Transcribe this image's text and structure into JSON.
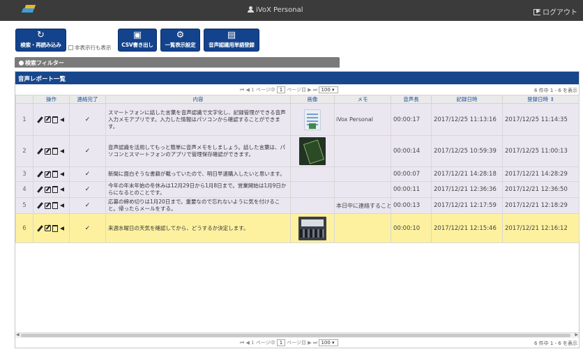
{
  "header": {
    "logo_text": "iVoX Personal",
    "title": "iVoX Personal",
    "logout_label": "ログアウト"
  },
  "toolbar": {
    "search_label": "検索・再読み込み",
    "show_hidden_label": "非表示行も表示",
    "csv_label": "CSV書き出し",
    "list_settings_label": "一覧表示設定",
    "word_register_label": "音声認識用単語登録"
  },
  "filter": {
    "label": "検索フィルター"
  },
  "panel": {
    "title": "音声レポート一覧"
  },
  "pager_top": {
    "prefix": "1 ページ中",
    "current_page": "1",
    "suffix": "ページ目",
    "page_size": "100 ▾",
    "count_text": "6 件中 1 - 6 を表示"
  },
  "pager_bottom": {
    "prefix": "1 ページ中",
    "current_page": "1",
    "suffix": "ページ目",
    "page_size": "100 ▾",
    "count_text": "6 件中 1 - 6 を表示"
  },
  "columns": {
    "num": "",
    "ops": "操作",
    "done": "連絡完了",
    "content": "内容",
    "image": "画像",
    "memo": "メモ",
    "length": "音声長",
    "recorded": "記録日時",
    "registered": "登録日時 ⇕"
  },
  "rows": [
    {
      "num": "1",
      "done": "✓",
      "content": "スマートフォンに話した言葉を音声認識で文字化し、記録管理ができる音声入力メモアプリです。入力した情報はパソコンから確認することができます。",
      "image": "document-thumbnail",
      "memo": "iVox Personal",
      "length": "00:00:17",
      "recorded": "2017/12/25 11:13:16",
      "registered": "2017/12/25 11:14:35"
    },
    {
      "num": "2",
      "done": "✓",
      "content": "音声認識を活用してもっと簡単に音声メモをしましょう。話した言葉は、パソコンとスマートフォンのアプリで管理保存確認ができます。",
      "image": "smartphone-thumbnail",
      "memo": "",
      "length": "00:00:14",
      "recorded": "2017/12/25 10:59:39",
      "registered": "2017/12/25 11:00:13"
    },
    {
      "num": "3",
      "done": "✓",
      "content": "新聞に面白そうな書籍が載っていたので、明日早速購入したいと思います。",
      "image": "",
      "memo": "",
      "length": "00:00:07",
      "recorded": "2017/12/21 14:28:18",
      "registered": "2017/12/21 14:28:29"
    },
    {
      "num": "4",
      "done": "✓",
      "content": "今年の年末年始の冬休みは12月29日から1月8日まで。営業開始は1月9日からになるとのことです。",
      "image": "",
      "memo": "",
      "length": "00:00:11",
      "recorded": "2017/12/21 12:36:36",
      "registered": "2017/12/21 12:36:50"
    },
    {
      "num": "5",
      "done": "✓",
      "content": "応募の締め切りは1月20日まで。重要なので忘れないように気を付けること。帰ったらメールをする。",
      "image": "",
      "memo": "本日中に連絡すること",
      "length": "00:00:13",
      "recorded": "2017/12/21 12:17:59",
      "registered": "2017/12/21 12:18:29"
    },
    {
      "num": "6",
      "done": "✓",
      "content": "来週水曜日の天気を確認してから、どうするか決定します。",
      "image": "meeting-room-thumbnail",
      "memo": "",
      "length": "00:00:10",
      "recorded": "2017/12/21 12:15:46",
      "registered": "2017/12/21 12:16:12"
    }
  ],
  "colors": {
    "header_bg": "#3b3b3b",
    "accent_blue": "#17468c",
    "row_alt": "#ebe7f1",
    "row_highlight": "#fdf1a0"
  }
}
